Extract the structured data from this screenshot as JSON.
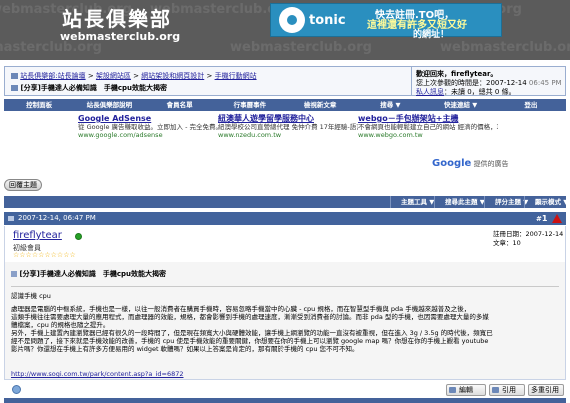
{
  "header": {
    "logo_cn": "站長俱樂部",
    "logo_en": "webmasterclub.org",
    "watermark": "webmasterclub.org",
    "banner": {
      "brand": "tonic",
      "line1": "快去註冊.TO吧，",
      "line2": "這裡還有許多又短又好",
      "line3": "的網址！"
    }
  },
  "navbar": {
    "breadcrumb": [
      "站長俱樂部:站長論壇",
      "架設網站區",
      "網站架設和網頁設計",
      "手機行動網站"
    ],
    "current_title": "[分享]手機達人必備知識　手機cpu效能大揭密",
    "user": {
      "welcome_label": "歡迎回來，",
      "username": "fireflytear",
      "separator": "。",
      "last_visit_label": "您上次參觀的時間是",
      "last_visit_date": "2007-12-14",
      "last_visit_time": "06:45 PM",
      "pm_label": "私人訊息",
      "pm_text": "：未讀 0，總共 0 條。"
    }
  },
  "menu": [
    "控制面板",
    "站長俱樂部說明",
    "會員名單",
    "行事曆事件",
    "檢視新文章",
    "搜尋 ▼",
    "快速連結 ▼",
    "登出"
  ],
  "ads": [
    {
      "title": "Google AdSense",
      "text": "從 Google 廣告賺取收益。立即加入 - 完全免費。",
      "url": "www.google.com/adsense"
    },
    {
      "title": "紐澳華人遊學留學服務中心",
      "text": "紐澳學校公司直營總代理 免仲介費 17年經驗-語言 打工度假 五星級遊學團",
      "url": "www.nzedu.com.tw"
    },
    {
      "title": "webgo－手包辦架站+主機",
      "text": "不會網頁也能輕鬆建立自己的網站 經濟的價格，功能強大的專業服務",
      "url": "www.webgo.com.tw"
    }
  ],
  "ads_by": {
    "google": "Google",
    "label": "提供的廣告"
  },
  "reply_button": "回覆主題",
  "thread_tools": [
    "主題工具 ▼",
    "搜尋此主題 ▼",
    "評分主題 ▼",
    "顯示模式 ▼"
  ],
  "post": {
    "date": "2007-12-14, 06:47 PM",
    "number_prefix": "#",
    "number": "1",
    "username": "fireflytear",
    "rank": "初級會員",
    "stars": "☆☆☆☆☆☆☆☆☆☆",
    "joined_label": "註冊日期：",
    "joined_date": "2007-12-14",
    "posts_label": "文章：",
    "posts_count": "10",
    "title": "[分享]手機達人必備知識　手機cpu效能大揭密",
    "body": [
      "認識手機 cpu",
      "處理器是電腦的中樞系統，手機也是一樣，以往一般消費者在購買手機時，容易忽略手機當中的心臟 - cpu 規格，而在智慧型手機與 pda 手機越來越普及之後，",
      "這類手機往往需要處理大量的應用程式，而處理器的效能，規格，都會影響到手機的處理速度，漸漸受到消費者的討論。而非 pda 型的手機，也因需要處理大量的多媒",
      "體檔案，cpu 的規格也隨之提升。",
      "另外，手機上建置內建瀏覽器已經有很久的一段時間了，但是現在頻寬大小與硬體效能，讓手機上網瀏覽的功能一直沒有被重視，但在進入 3g / 3.5g 的時代後，頻寬已",
      "經不是問題了，接下來就是手機效能的改善，手機的 cpu 使是手機效能的重要關鍵，你想要在你的手機上可以瀏覽 google map 嗎？你想在你的手機上觀看 youtube",
      "影片嗎？你還想在手機上有許多方便易用的 widget 軟體嗎？如果以上答案是肯定的，那有關於手機的 cpu 您不可不知。"
    ],
    "link": "http://www.sogi.com.tw/park/content.asp?a_id=6872",
    "buttons": {
      "edit": "編輯",
      "quote": "引用",
      "multi": "多重引用"
    }
  }
}
